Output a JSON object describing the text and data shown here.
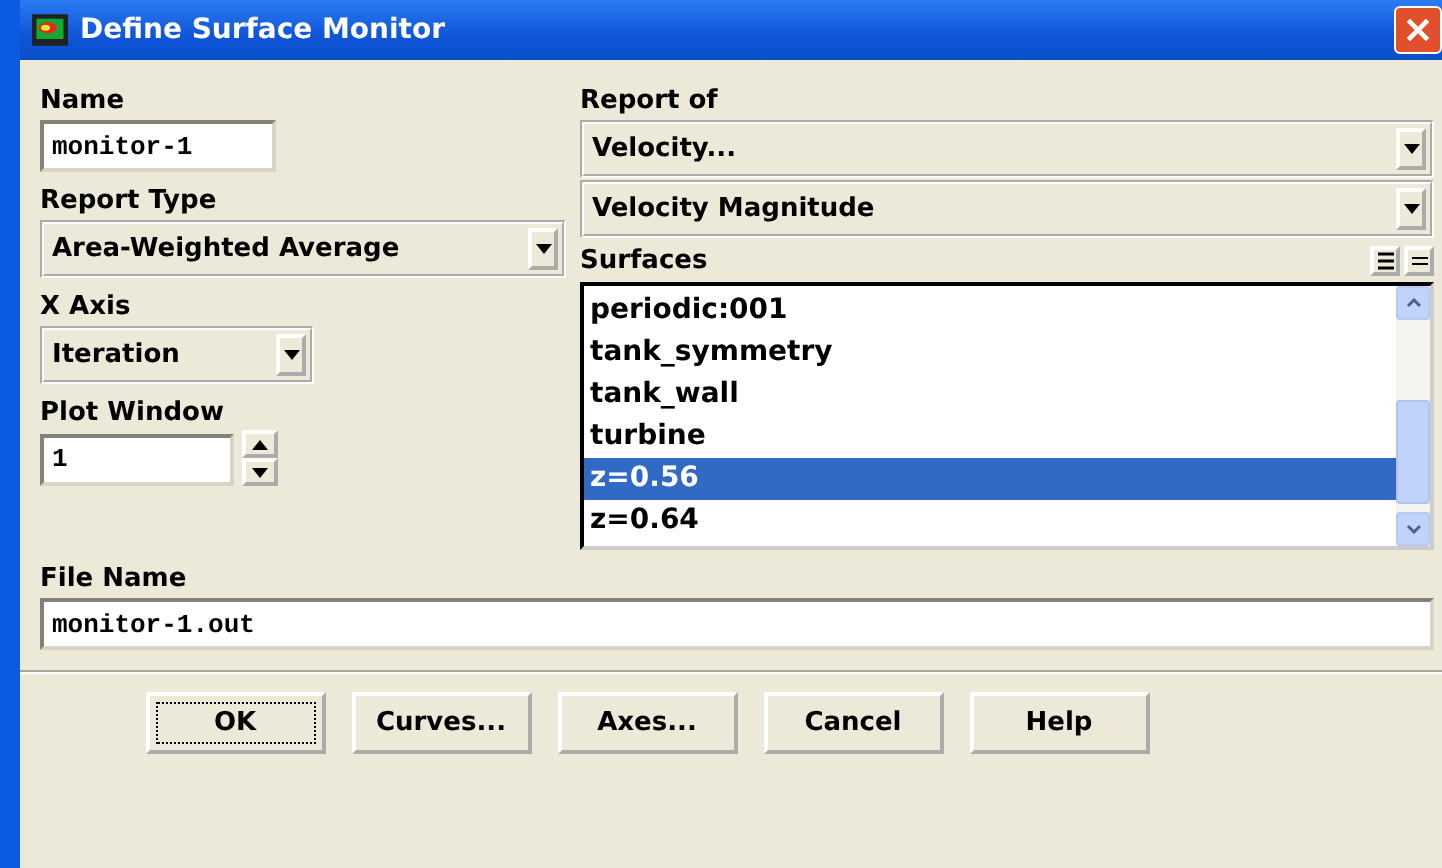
{
  "window": {
    "title": "Define Surface Monitor"
  },
  "name": {
    "label": "Name",
    "value": "monitor-1"
  },
  "report_type": {
    "label": "Report Type",
    "value": "Area-Weighted Average"
  },
  "x_axis": {
    "label": "X Axis",
    "value": "Iteration"
  },
  "plot_window": {
    "label": "Plot Window",
    "value": "1"
  },
  "report_of": {
    "label": "Report of",
    "value": "Velocity...",
    "sub_value": "Velocity Magnitude"
  },
  "surfaces": {
    "label": "Surfaces",
    "items": [
      {
        "label": "periodic:001",
        "selected": false
      },
      {
        "label": "tank_symmetry",
        "selected": false
      },
      {
        "label": "tank_wall",
        "selected": false
      },
      {
        "label": "turbine",
        "selected": false
      },
      {
        "label": "z=0.56",
        "selected": true
      },
      {
        "label": "z=0.64",
        "selected": false
      }
    ]
  },
  "file_name": {
    "label": "File Name",
    "value": "monitor-1.out"
  },
  "buttons": [
    {
      "label": "OK",
      "focused": true
    },
    {
      "label": "Curves...",
      "focused": false
    },
    {
      "label": "Axes...",
      "focused": false
    },
    {
      "label": "Cancel",
      "focused": false
    },
    {
      "label": "Help",
      "focused": false
    }
  ]
}
